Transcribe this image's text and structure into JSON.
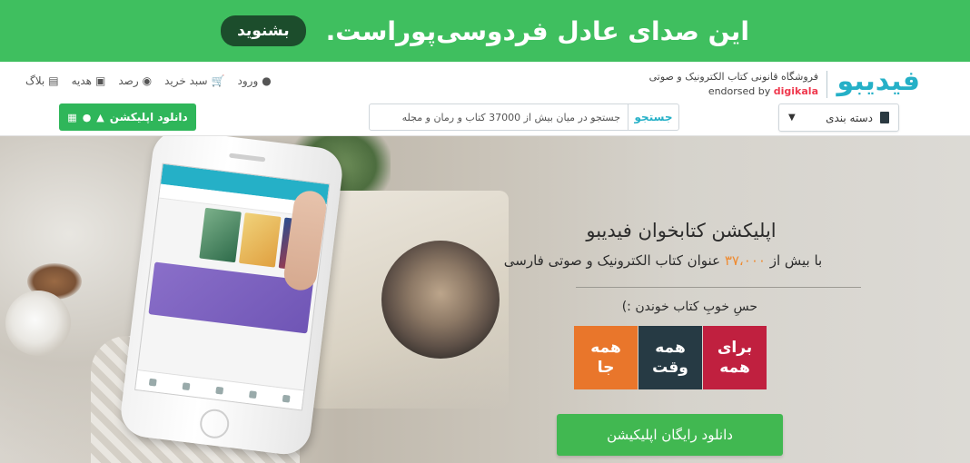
{
  "promo": {
    "text": "این صدای عادل فردوسی‌پوراست.",
    "button": "بشنوید",
    "background": "#3fbf5f"
  },
  "header": {
    "logo": "فیدیبو",
    "tagline": "فروشگاه قانونی کتاب الکترونیک و صوتی",
    "endorsed_prefix": "endorsed by ",
    "endorsed_brand": "digikala",
    "nav": [
      {
        "label": "ورود",
        "icon": "user-icon"
      },
      {
        "label": "سبد خرید",
        "icon": "cart-icon"
      },
      {
        "label": "رصد",
        "icon": "eye-icon"
      },
      {
        "label": "هدیه",
        "icon": "gift-icon"
      },
      {
        "label": "بلاگ",
        "icon": "blog-icon"
      }
    ],
    "app_download": {
      "label": "دانلود اپلیکشن",
      "icons": [
        "windows-icon",
        "apple-icon",
        "android-icon"
      ]
    },
    "search": {
      "button": "جستجو",
      "placeholder": "جستجو در میان بیش از 37000 کتاب و رمان و مجله"
    },
    "category": {
      "label": "دسته بندی",
      "icon": "book-icon"
    }
  },
  "hero": {
    "title": "اپلیکشن کتابخوان فیدیبو",
    "subtitle_prefix": "با بیش از ",
    "subtitle_number": "۳۷،۰۰۰",
    "subtitle_suffix": " عنوان کتاب الکترونیک و صوتی فارسی",
    "tagline": "حسِ خوبِ کتاب خوندن :)",
    "tiles": [
      {
        "line1": "برای",
        "line2": "همه",
        "color": "#c0203f"
      },
      {
        "line1": "همه",
        "line2": "وقت",
        "color": "#263a44"
      },
      {
        "line1": "همه",
        "line2": "جا",
        "color": "#e9762b"
      }
    ],
    "download_button": "دانلود رایگان اپلیکیشن"
  }
}
